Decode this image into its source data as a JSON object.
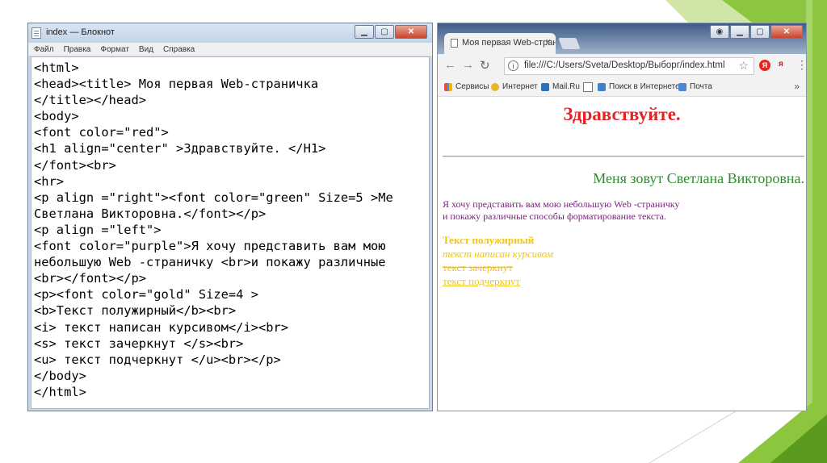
{
  "colors": {
    "slide_green": "#8cc63f",
    "slide_green_dark": "#5a9a1e",
    "heading_red": "#e32326",
    "green_text": "#2e8b2e",
    "purple_text": "#7b217f",
    "gold_text": "#f0c419"
  },
  "notepad": {
    "title": "index — Блокнот",
    "menu": [
      "Файл",
      "Правка",
      "Формат",
      "Вид",
      "Справка"
    ],
    "code_lines": [
      "<html>",
      "<head><title> Моя первая Web-страничка",
      "</title></head>",
      "<body>",
      "<font color=\"red\">",
      "<h1 align=\"center\" >Здравствуйте. </H1>",
      "</font><br>",
      "<hr>",
      "<p align =\"right\"><font color=\"green\" Size=5 >Ме",
      "Светлана Викторовна.</font></p>",
      "<p align =\"left\">",
      "<font color=\"purple\">Я хочу представить вам мою",
      "небольшую Web -страничку <br>и покажу различные",
      "<br></font></p>",
      "<p><font color=\"gold\" Size=4 >",
      "<b>Текст полужирный</b><br>",
      "<i> текст написан курсивом</i><br>",
      "<s> текст зачеркнут </s><br>",
      "<u> текст подчеркнут </u><br></p>",
      "</body>",
      "</html>"
    ]
  },
  "browser": {
    "tab_title": "Моя первая Web-страни",
    "tab_close": "×",
    "url": "file:///C:/Users/Sveta/Desktop/Выборг/index.html",
    "info_symbol": "i",
    "ext_y": "Я",
    "ext_ya": "я",
    "bookmarks": [
      {
        "label": "Сервисы",
        "icon": "apps-grid-icon"
      },
      {
        "label": "Интернет",
        "icon": "chrome-icon"
      },
      {
        "label": "Mail.Ru",
        "icon": "mailru-icon"
      },
      {
        "label": "",
        "icon": "page-icon"
      },
      {
        "label": "Поиск в Интернете",
        "icon": "search-page-icon"
      },
      {
        "label": "Почта",
        "icon": "mail-icon"
      }
    ],
    "more_symbol": "»",
    "page": {
      "heading": "Здравствуйте.",
      "right_text": "Меня зовут Светлана Викторовна.",
      "purple_line1": "Я хочу представить вам мою небольшую Web -страничку",
      "purple_line2": "и покажу различные способы форматирование текста.",
      "bold_text": "Текст полужирный",
      "italic_text": "текст написан курсивом",
      "strike_text": "текст зачеркнут",
      "underline_text": "текст подчеркнут"
    }
  }
}
